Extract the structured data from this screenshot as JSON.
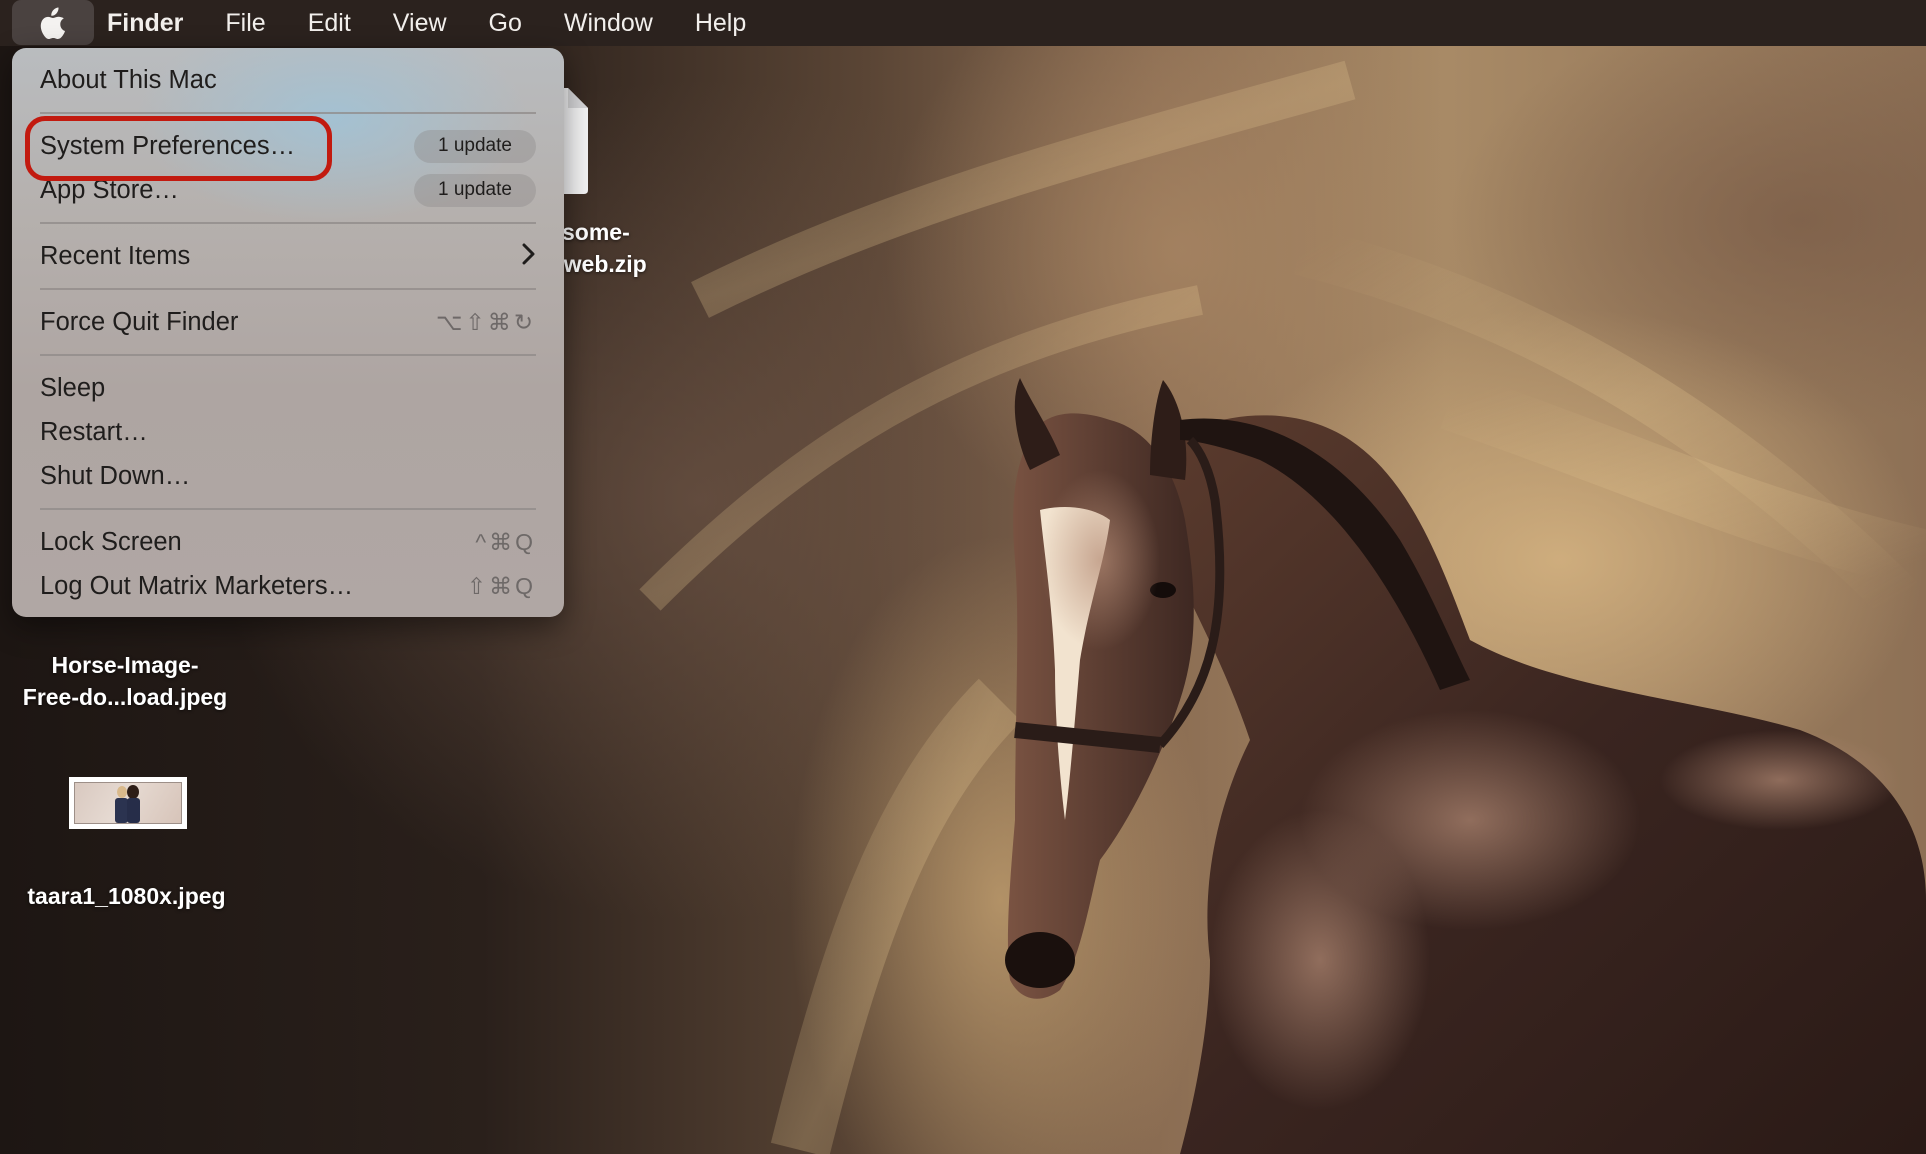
{
  "menubar": {
    "apple_icon": "apple-logo-icon",
    "items": [
      {
        "label": "Finder",
        "bold": true
      },
      {
        "label": "File"
      },
      {
        "label": "Edit"
      },
      {
        "label": "View"
      },
      {
        "label": "Go"
      },
      {
        "label": "Window"
      },
      {
        "label": "Help"
      }
    ]
  },
  "apple_menu": {
    "items": [
      {
        "label": "About This Mac"
      },
      {
        "label": "System Preferences…",
        "badge": "1 update",
        "highlighted_by_annotation": true
      },
      {
        "label": "App Store…",
        "badge": "1 update"
      },
      {
        "label": "Recent Items",
        "submenu_icon": "chevron-right-icon"
      },
      {
        "label": "Force Quit Finder",
        "shortcut": "⌥⇧⌘⎋"
      },
      {
        "label": "Sleep"
      },
      {
        "label": "Restart…"
      },
      {
        "label": "Shut Down…"
      },
      {
        "label": "Lock Screen",
        "shortcut": "^⌘Q"
      },
      {
        "label": "Log Out Matrix Marketers…",
        "shortcut": "⇧⌘Q"
      }
    ],
    "shortcut_keys": {
      "force_quit": [
        "⌥",
        "⇧",
        "⌘",
        "↻"
      ],
      "lock_screen": [
        "^",
        "⌘",
        "Q"
      ],
      "log_out": [
        "⇧",
        "⌘",
        "Q"
      ]
    }
  },
  "annotation": {
    "color": "#c21a0f",
    "target": "System Preferences…"
  },
  "desktop": {
    "files": [
      {
        "name_line1": "some-",
        "name_line2": "-web.zip",
        "icon": "zip-file-icon"
      },
      {
        "name_line1": "Horse-Image-",
        "name_line2": "Free-do...load.jpeg",
        "icon": "image-file-icon"
      },
      {
        "name_line1": "taara1_1080x.jpeg",
        "icon": "image-thumbnail"
      }
    ],
    "wallpaper": "sepia horse photograph"
  },
  "colors": {
    "menubar_bg": "#2b221e",
    "menu_text": "#1f1d1c",
    "shortcut_text": "#6e6968",
    "annotation_red": "#c21a0f"
  }
}
